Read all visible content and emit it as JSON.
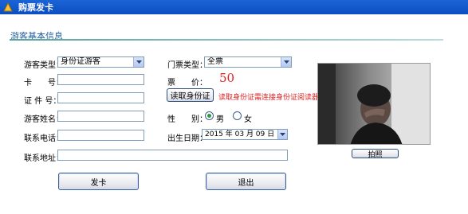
{
  "window": {
    "title": "购票发卡"
  },
  "section": {
    "title": "游客基本信息"
  },
  "form": {
    "visitor_type": {
      "label": "游客类型：",
      "value": "身份证游客"
    },
    "card_no": {
      "label": "卡　　号：",
      "value": ""
    },
    "id_no": {
      "label": "证 件 号：",
      "value": ""
    },
    "visitor_name": {
      "label": "游客姓名：",
      "value": ""
    },
    "phone": {
      "label": "联系电话：",
      "value": ""
    },
    "address": {
      "label": "联系地址：",
      "value": ""
    },
    "ticket_type": {
      "label": "门票类型：",
      "value": "全票"
    },
    "price": {
      "label": "票　　价：",
      "value": "50"
    },
    "gender": {
      "label": "性　　别：",
      "options": [
        "男",
        "女"
      ],
      "selected": "男"
    },
    "birth_date": {
      "label": "出生日期：",
      "value": "2015 年 03 月 09 日"
    }
  },
  "buttons": {
    "read_id": "读取身份证",
    "read_id_hint": "读取身份证需连接身份证阅读器",
    "photo": "拍照",
    "issue_card": "发卡",
    "exit": "退出"
  },
  "colors": {
    "titlebar": "#0a4fc2",
    "section_title": "#1f5a9e",
    "warning": "#e02020",
    "price": "#e02020"
  }
}
